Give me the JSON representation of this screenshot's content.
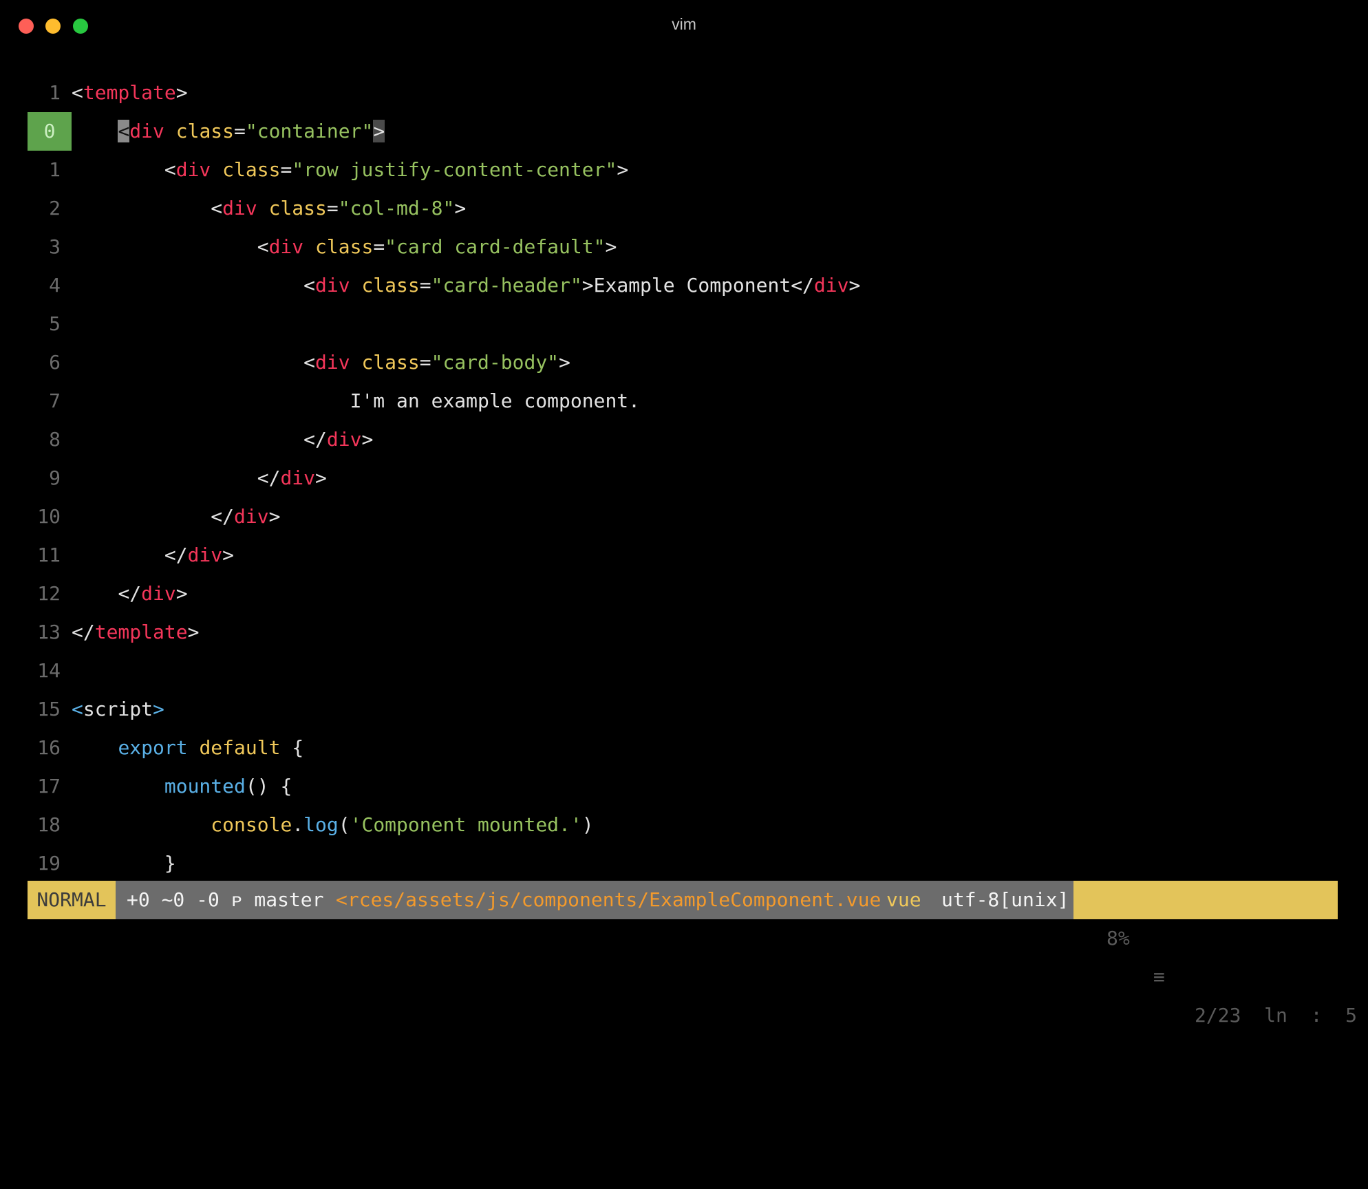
{
  "window": {
    "title": "vim"
  },
  "editor": {
    "lines": [
      {
        "num": "1",
        "indent": "",
        "tokens": [
          [
            "p",
            "<"
          ],
          [
            "tag",
            "template"
          ],
          [
            "p",
            ">"
          ]
        ]
      },
      {
        "num": "0",
        "indent": "    ",
        "current": true,
        "tokens": [
          [
            "cursor",
            "<"
          ],
          [
            "tag",
            "div"
          ],
          [
            "p",
            " "
          ],
          [
            "attr",
            "class"
          ],
          [
            "p",
            "="
          ],
          [
            "str",
            "\"container\""
          ],
          [
            "match",
            ">"
          ]
        ]
      },
      {
        "num": "1",
        "indent": "        ",
        "tokens": [
          [
            "p",
            "<"
          ],
          [
            "tag",
            "div"
          ],
          [
            "p",
            " "
          ],
          [
            "attr",
            "class"
          ],
          [
            "p",
            "="
          ],
          [
            "str",
            "\"row justify-content-center\""
          ],
          [
            "p",
            ">"
          ]
        ]
      },
      {
        "num": "2",
        "indent": "            ",
        "tokens": [
          [
            "p",
            "<"
          ],
          [
            "tag",
            "div"
          ],
          [
            "p",
            " "
          ],
          [
            "attr",
            "class"
          ],
          [
            "p",
            "="
          ],
          [
            "str",
            "\"col-md-8\""
          ],
          [
            "p",
            ">"
          ]
        ]
      },
      {
        "num": "3",
        "indent": "                ",
        "tokens": [
          [
            "p",
            "<"
          ],
          [
            "tag",
            "div"
          ],
          [
            "p",
            " "
          ],
          [
            "attr",
            "class"
          ],
          [
            "p",
            "="
          ],
          [
            "str",
            "\"card card-default\""
          ],
          [
            "p",
            ">"
          ]
        ]
      },
      {
        "num": "4",
        "indent": "                    ",
        "tokens": [
          [
            "p",
            "<"
          ],
          [
            "tag",
            "div"
          ],
          [
            "p",
            " "
          ],
          [
            "attr",
            "class"
          ],
          [
            "p",
            "="
          ],
          [
            "str",
            "\"card-header\""
          ],
          [
            "p",
            ">"
          ],
          [
            "txt",
            "Example Component"
          ],
          [
            "p",
            "</"
          ],
          [
            "tag",
            "div"
          ],
          [
            "p",
            ">"
          ]
        ]
      },
      {
        "num": "5",
        "indent": "",
        "tokens": []
      },
      {
        "num": "6",
        "indent": "                    ",
        "tokens": [
          [
            "p",
            "<"
          ],
          [
            "tag",
            "div"
          ],
          [
            "p",
            " "
          ],
          [
            "attr",
            "class"
          ],
          [
            "p",
            "="
          ],
          [
            "str",
            "\"card-body\""
          ],
          [
            "p",
            ">"
          ]
        ]
      },
      {
        "num": "7",
        "indent": "                        ",
        "tokens": [
          [
            "txt",
            "I'm an example component."
          ]
        ]
      },
      {
        "num": "8",
        "indent": "                    ",
        "tokens": [
          [
            "p",
            "</"
          ],
          [
            "tag",
            "div"
          ],
          [
            "p",
            ">"
          ]
        ]
      },
      {
        "num": "9",
        "indent": "                ",
        "tokens": [
          [
            "p",
            "</"
          ],
          [
            "tag",
            "div"
          ],
          [
            "p",
            ">"
          ]
        ]
      },
      {
        "num": "10",
        "indent": "            ",
        "tokens": [
          [
            "p",
            "</"
          ],
          [
            "tag",
            "div"
          ],
          [
            "p",
            ">"
          ]
        ]
      },
      {
        "num": "11",
        "indent": "        ",
        "tokens": [
          [
            "p",
            "</"
          ],
          [
            "tag",
            "div"
          ],
          [
            "p",
            ">"
          ]
        ]
      },
      {
        "num": "12",
        "indent": "    ",
        "tokens": [
          [
            "p",
            "</"
          ],
          [
            "tag",
            "div"
          ],
          [
            "p",
            ">"
          ]
        ]
      },
      {
        "num": "13",
        "indent": "",
        "tokens": [
          [
            "p",
            "</"
          ],
          [
            "tag",
            "template"
          ],
          [
            "p",
            ">"
          ]
        ]
      },
      {
        "num": "14",
        "indent": "",
        "tokens": []
      },
      {
        "num": "15",
        "indent": "",
        "tokens": [
          [
            "kw",
            "<"
          ],
          [
            "p",
            "script"
          ],
          [
            "kw",
            ">"
          ]
        ]
      },
      {
        "num": "16",
        "indent": "    ",
        "tokens": [
          [
            "kw",
            "export"
          ],
          [
            "p",
            " "
          ],
          [
            "kw2",
            "default"
          ],
          [
            "p",
            " {"
          ]
        ]
      },
      {
        "num": "17",
        "indent": "        ",
        "tokens": [
          [
            "fn",
            "mounted"
          ],
          [
            "p",
            "() {"
          ]
        ]
      },
      {
        "num": "18",
        "indent": "            ",
        "tokens": [
          [
            "ident",
            "console"
          ],
          [
            "p",
            "."
          ],
          [
            "fn",
            "log"
          ],
          [
            "p",
            "("
          ],
          [
            "str",
            "'Component mounted.'"
          ],
          [
            "p",
            ")"
          ]
        ]
      },
      {
        "num": "19",
        "indent": "        ",
        "tokens": [
          [
            "p",
            "}"
          ]
        ]
      }
    ]
  },
  "statusline": {
    "mode": "NORMAL",
    "git": "+0 ~0 -0 ᴘ master",
    "path": "<rces/assets/js/components/ExampleComponent.vue",
    "filetype": "vue",
    "encoding": "utf-8[unix]",
    "percent": "8%",
    "menu_glyph": "≡",
    "position": "2/23  ln  :  5"
  },
  "colors": {
    "tag": "#f4365a",
    "attr": "#f0c85a",
    "string": "#97c260",
    "keyword": "#5ab0e6",
    "mode_bg": "#e3c45a",
    "path": "#f39a2c"
  }
}
